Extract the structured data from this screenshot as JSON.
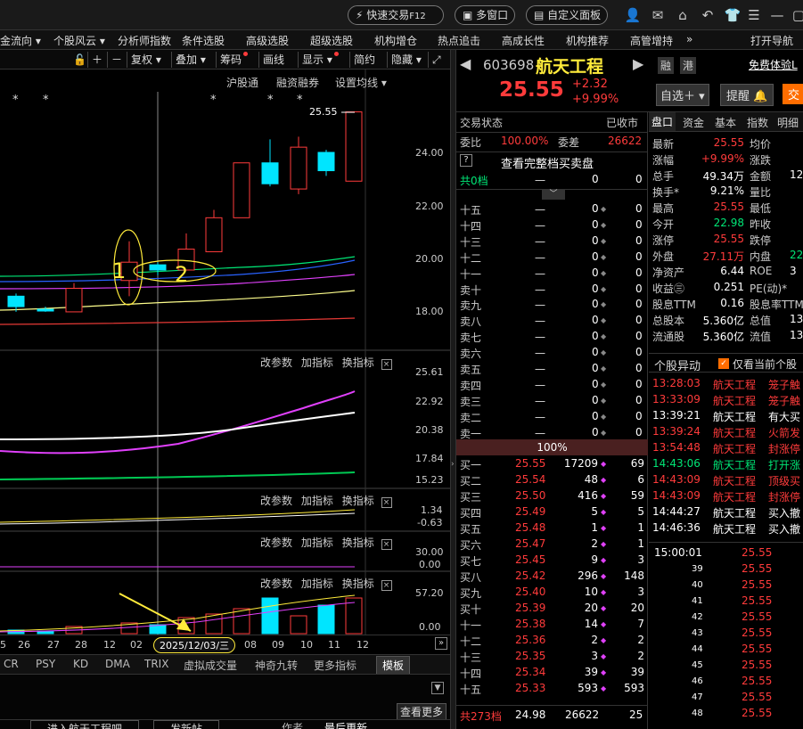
{
  "titlebar": {
    "quick_trade": "快速交易",
    "quick_trade_key": "F12",
    "multi_window": "多窗口",
    "custom_panel": "自定义面板"
  },
  "menu": [
    "金流向 ▾",
    "个股风云 ▾",
    "分析师指数",
    "条件选股",
    "高级选股",
    "超级选股",
    "机构增仓",
    "热点追击",
    "高成长性",
    "机构推荐",
    "高管增持"
  ],
  "menu_more": "»",
  "menu_right": "打开导航",
  "chart_toolbar": {
    "fuquan": "复权",
    "diejia": "叠加",
    "chouma": "筹码",
    "huaxian": "画线",
    "xianshi": "显示",
    "jianyue": "简约",
    "yincang": "隐藏"
  },
  "main_panel": {
    "tabs": [
      "沪股通",
      "融资融券",
      "设置均线 ▾"
    ],
    "price_label": "25.55",
    "y_ticks": [
      "24.00",
      "22.00",
      "20.00",
      "18.00"
    ],
    "annotation_1": "1",
    "annotation_2": "2"
  },
  "sub_panels": {
    "gaicanshu": "改参数",
    "jiazhibiao": "加指标",
    "huanzhibiao": "换指标",
    "p1_ticks": [
      "25.61",
      "22.92",
      "20.38",
      "17.84",
      "15.23"
    ],
    "p2_ticks": [
      "1.34",
      "-0.63"
    ],
    "p3_ticks": [
      "30.00",
      "0.00"
    ],
    "p4_ticks": [
      "57.20",
      "0.00"
    ]
  },
  "date_axis": {
    "labels": [
      "5",
      "26",
      "27",
      "28",
      "12",
      "02",
      "08",
      "09",
      "10",
      "11",
      "12"
    ],
    "hover_date": "2025/12/03/三"
  },
  "indicator_tabs": [
    "CR",
    "PSY",
    "KD",
    "DMA",
    "TRIX",
    "虚拟成交量",
    "神奇九转",
    "更多指标"
  ],
  "indicator_active": "模板",
  "bottom": {
    "more": "查看更多",
    "left_btn": "进入航天工程吧",
    "post_btn": "发新帖",
    "author": "作者",
    "last_update": "最后更新"
  },
  "stock": {
    "code": "603698",
    "name": "航天工程",
    "rong": "融",
    "gang": "港",
    "free_trial": "免费体验L",
    "price": "25.55",
    "change": "+2.32",
    "pct": "+9.99%",
    "watch_btn": "自选＋ ▾",
    "alert_btn": "提醒",
    "trade_btn": "交"
  },
  "orderbook": {
    "status_label": "交易状态",
    "status_value": "已收市",
    "weibi_label": "委比",
    "weibi_value": "100.00%",
    "weicha_label": "委差",
    "weicha_value": "26622",
    "view_full": "查看完整档买卖盘",
    "total_sell_label": "共0档",
    "total_sell_v1": "一",
    "total_sell_v2": "0",
    "total_sell_v3": "0",
    "sell": [
      {
        "label": "十五",
        "price": "一",
        "vol": "0",
        "cnt": "0"
      },
      {
        "label": "十四",
        "price": "一",
        "vol": "0",
        "cnt": "0"
      },
      {
        "label": "十三",
        "price": "一",
        "vol": "0",
        "cnt": "0"
      },
      {
        "label": "十二",
        "price": "一",
        "vol": "0",
        "cnt": "0"
      },
      {
        "label": "十一",
        "price": "一",
        "vol": "0",
        "cnt": "0"
      },
      {
        "label": "卖十",
        "price": "一",
        "vol": "0",
        "cnt": "0"
      },
      {
        "label": "卖九",
        "price": "一",
        "vol": "0",
        "cnt": "0"
      },
      {
        "label": "卖八",
        "price": "一",
        "vol": "0",
        "cnt": "0"
      },
      {
        "label": "卖七",
        "price": "一",
        "vol": "0",
        "cnt": "0"
      },
      {
        "label": "卖六",
        "price": "一",
        "vol": "0",
        "cnt": "0"
      },
      {
        "label": "卖五",
        "price": "一",
        "vol": "0",
        "cnt": "0"
      },
      {
        "label": "卖四",
        "price": "一",
        "vol": "0",
        "cnt": "0"
      },
      {
        "label": "卖三",
        "price": "一",
        "vol": "0",
        "cnt": "0"
      },
      {
        "label": "卖二",
        "price": "一",
        "vol": "0",
        "cnt": "0"
      },
      {
        "label": "卖一",
        "price": "一",
        "vol": "0",
        "cnt": "0"
      }
    ],
    "ratio": "100%",
    "buy": [
      {
        "label": "买一",
        "price": "25.55",
        "vol": "17209",
        "cnt": "69"
      },
      {
        "label": "买二",
        "price": "25.54",
        "vol": "48",
        "cnt": "6"
      },
      {
        "label": "买三",
        "price": "25.50",
        "vol": "416",
        "cnt": "59"
      },
      {
        "label": "买四",
        "price": "25.49",
        "vol": "5",
        "cnt": "5"
      },
      {
        "label": "买五",
        "price": "25.48",
        "vol": "1",
        "cnt": "1"
      },
      {
        "label": "买六",
        "price": "25.47",
        "vol": "2",
        "cnt": "1"
      },
      {
        "label": "买七",
        "price": "25.45",
        "vol": "9",
        "cnt": "3"
      },
      {
        "label": "买八",
        "price": "25.42",
        "vol": "296",
        "cnt": "148"
      },
      {
        "label": "买九",
        "price": "25.40",
        "vol": "10",
        "cnt": "3"
      },
      {
        "label": "买十",
        "price": "25.39",
        "vol": "20",
        "cnt": "20"
      },
      {
        "label": "十一",
        "price": "25.38",
        "vol": "14",
        "cnt": "7"
      },
      {
        "label": "十二",
        "price": "25.36",
        "vol": "2",
        "cnt": "2"
      },
      {
        "label": "十三",
        "price": "25.35",
        "vol": "3",
        "cnt": "2"
      },
      {
        "label": "十四",
        "price": "25.34",
        "vol": "39",
        "cnt": "39"
      },
      {
        "label": "十五",
        "price": "25.33",
        "vol": "593",
        "cnt": "593"
      }
    ],
    "total_buy_label": "共273档",
    "total_buy_price": "24.98",
    "total_buy_vol": "26622",
    "total_buy_cnt": "25"
  },
  "quote": {
    "tabs": [
      "盘口",
      "资金",
      "基本",
      "指数",
      "明细"
    ],
    "rows": [
      {
        "l1": "最新",
        "v1": "25.55",
        "l2": "均价"
      },
      {
        "l1": "涨幅",
        "v1": "+9.99%",
        "l2": "涨跌"
      },
      {
        "l1": "总手",
        "v1": "49.34万",
        "l2": "金额",
        "v2": "12"
      },
      {
        "l1": "换手*",
        "v1": "9.21%",
        "l2": "量比"
      },
      {
        "l1": "最高",
        "v1": "25.55",
        "l2": "最低"
      },
      {
        "l1": "今开",
        "v1": "22.98",
        "l2": "昨收"
      },
      {
        "l1": "涨停",
        "v1": "25.55",
        "l2": "跌停"
      },
      {
        "l1": "外盘",
        "v1": "27.11万",
        "l2": "内盘",
        "v2": "22"
      },
      {
        "l1": "净资产",
        "v1": "6.44",
        "l2": "ROE",
        "v2": "3"
      },
      {
        "l1": "收益㊂",
        "v1": "0.251",
        "l2": "PE(动)*"
      },
      {
        "l1": "股息TTM",
        "v1": "0.16",
        "l2": "股息率TTM"
      },
      {
        "l1": "总股本",
        "v1": "5.360亿",
        "l2": "总值",
        "v2": "13"
      },
      {
        "l1": "流通股",
        "v1": "5.360亿",
        "l2": "流值",
        "v2": "13"
      }
    ],
    "events_title": "个股异动",
    "events_only": "仅看当前个股",
    "events": [
      {
        "time": "13:28:03",
        "name": "航天工程",
        "desc": "笼子触"
      },
      {
        "time": "13:33:09",
        "name": "航天工程",
        "desc": "笼子触"
      },
      {
        "time": "13:39:21",
        "name": "航天工程",
        "desc": "有大买"
      },
      {
        "time": "13:39:24",
        "name": "航天工程",
        "desc": "火箭发"
      },
      {
        "time": "13:54:48",
        "name": "航天工程",
        "desc": "封涨停"
      },
      {
        "time": "14:43:06",
        "name": "航天工程",
        "desc": "打开涨"
      },
      {
        "time": "14:43:09",
        "name": "航天工程",
        "desc": "顶级买"
      },
      {
        "time": "14:43:09",
        "name": "航天工程",
        "desc": "封涨停"
      },
      {
        "time": "14:44:27",
        "name": "航天工程",
        "desc": "买入撤"
      },
      {
        "time": "14:46:36",
        "name": "航天工程",
        "desc": "买入撤"
      }
    ],
    "ticks": [
      {
        "t": "15:00:01",
        "p": "25.55"
      },
      {
        "t": "39",
        "p": "25.55"
      },
      {
        "t": "40",
        "p": "25.55"
      },
      {
        "t": "41",
        "p": "25.55"
      },
      {
        "t": "42",
        "p": "25.55"
      },
      {
        "t": "43",
        "p": "25.55"
      },
      {
        "t": "44",
        "p": "25.55"
      },
      {
        "t": "45",
        "p": "25.55"
      },
      {
        "t": "46",
        "p": "25.55"
      },
      {
        "t": "47",
        "p": "25.55"
      },
      {
        "t": "48",
        "p": "25.55"
      }
    ]
  },
  "chart_data": {
    "type": "candlestick",
    "y_range": [
      17.0,
      25.9
    ],
    "candles": [
      {
        "o": 18.5,
        "c": 18.1,
        "h": 18.6,
        "l": 17.9,
        "color": "cyan"
      },
      {
        "o": 18.0,
        "c": 17.95,
        "h": 18.1,
        "l": 17.9,
        "color": "cyan"
      },
      {
        "o": 17.9,
        "c": 18.8,
        "h": 19.0,
        "l": 17.9,
        "color": "red"
      },
      {
        "o": 19.1,
        "c": 19.8,
        "h": 20.6,
        "l": 18.5,
        "color": "red"
      },
      {
        "o": 19.7,
        "c": 19.5,
        "h": 19.8,
        "l": 19.3,
        "color": "cyan"
      },
      {
        "o": 19.5,
        "c": 20.3,
        "h": 20.9,
        "l": 19.5,
        "color": "red"
      },
      {
        "o": 20.2,
        "c": 21.5,
        "h": 21.8,
        "l": 20.2,
        "color": "red"
      },
      {
        "o": 21.5,
        "c": 23.6,
        "h": 23.6,
        "l": 21.5,
        "color": "red"
      },
      {
        "o": 23.6,
        "c": 22.8,
        "h": 24.5,
        "l": 22.7,
        "color": "cyan"
      },
      {
        "o": 22.6,
        "c": 24.2,
        "h": 24.6,
        "l": 22.4,
        "color": "red"
      },
      {
        "o": 24.0,
        "c": 23.3,
        "h": 24.1,
        "l": 23.1,
        "color": "cyan"
      },
      {
        "o": 22.9,
        "c": 25.55,
        "h": 25.55,
        "l": 22.9,
        "color": "red"
      }
    ]
  }
}
